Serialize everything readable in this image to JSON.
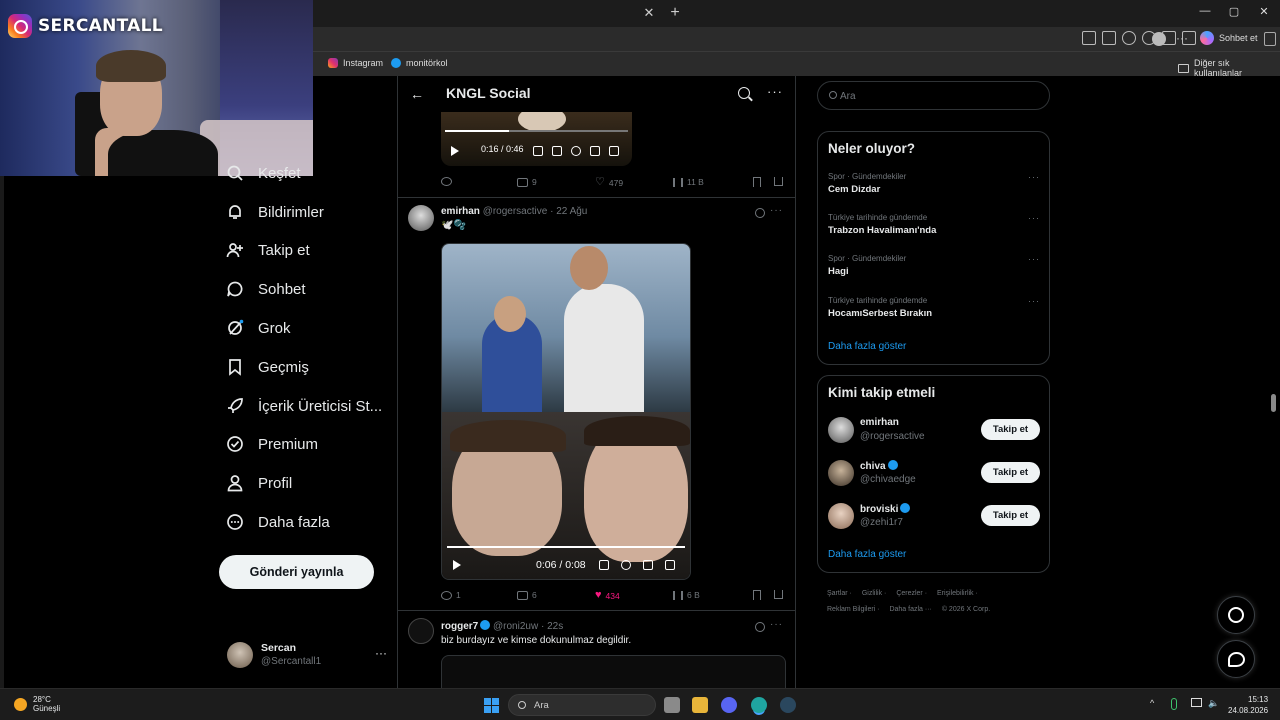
{
  "browser": {
    "window_controls": [
      "—",
      "▢",
      "✕"
    ],
    "tab_close": "✕",
    "new_tab": "+",
    "copilot_label": "Sohbet et",
    "favorites": [
      "Instagram",
      "monitörkol"
    ],
    "other_favorites": "Diğer sık kullanılanlar"
  },
  "overlay": {
    "instagram_handle": "SERCANTALL"
  },
  "nav": {
    "items": [
      {
        "label": "Keşfet"
      },
      {
        "label": "Bildirimler"
      },
      {
        "label": "Takip et"
      },
      {
        "label": "Sohbet"
      },
      {
        "label": "Grok"
      },
      {
        "label": "Geçmiş"
      },
      {
        "label": "İçerik Üreticisi St..."
      },
      {
        "label": "Premium"
      },
      {
        "label": "Profil"
      },
      {
        "label": "Daha fazla"
      }
    ],
    "post_button": "Gönderi yayınla",
    "account": {
      "name": "Sercan",
      "handle": "@Sercantall1",
      "more": "···"
    }
  },
  "main": {
    "back": "←",
    "title": "KNGL Social",
    "more": "···",
    "tweet0": {
      "video_time": "0:16 / 0:46",
      "video_progress": 0.35,
      "replies": "",
      "retweets": "9",
      "likes": "479",
      "views": "11 B"
    },
    "tweet1": {
      "name": "emirhan",
      "handle": "@rogersactive",
      "date": "22 Ağu",
      "text": "🕊️🫧",
      "video_time": "0:06 / 0:08",
      "replies": "1",
      "retweets": "6",
      "likes": "434",
      "views": "6 B",
      "more": "···"
    },
    "tweet2": {
      "name": "rogger7",
      "handle": "@roni2uw",
      "date": "22s",
      "text": "biz burdayız ve kimse dokunulmaz degildir.",
      "more": "···"
    }
  },
  "sidebar": {
    "search_placeholder": "Ara",
    "trends_title": "Neler oluyor?",
    "trends": [
      {
        "category": "Spor · Gündemdekiler",
        "title": "Cem Dizdar"
      },
      {
        "category": "Türkiye tarihinde gündemde",
        "title": "Trabzon Havalimanı'nda"
      },
      {
        "category": "Spor · Gündemdekiler",
        "title": "Hagi"
      },
      {
        "category": "Türkiye tarihinde gündemde",
        "title": "HocamıSerbest Bırakın"
      }
    ],
    "trends_more": "Daha fazla göster",
    "who_title": "Kimi takip etmeli",
    "who": [
      {
        "name": "emirhan",
        "handle": "@rogersactive",
        "button": "Takip et",
        "verified": false
      },
      {
        "name": "chiva",
        "handle": "@chivaedge",
        "button": "Takip et",
        "verified": true
      },
      {
        "name": "broviski",
        "handle": "@zehi1r7",
        "button": "Takip et",
        "verified": true
      }
    ],
    "who_more": "Daha fazla göster",
    "footer": {
      "row1": [
        "Şartlar ·",
        "Gizlilik ·",
        "Çerezler ·",
        "Erişilebilirlik ·"
      ],
      "row2": [
        "Reklam Bilgileri ·",
        "Daha fazla ···",
        "© 2026 X Corp."
      ]
    }
  },
  "taskbar": {
    "temperature": "28°C",
    "weather": "Güneşli",
    "search_label": "Ara",
    "time": "15:13",
    "date": "24.08.2026"
  },
  "colors": {
    "accent": "#1d9bf0",
    "like": "#f91880",
    "background": "#000000"
  }
}
